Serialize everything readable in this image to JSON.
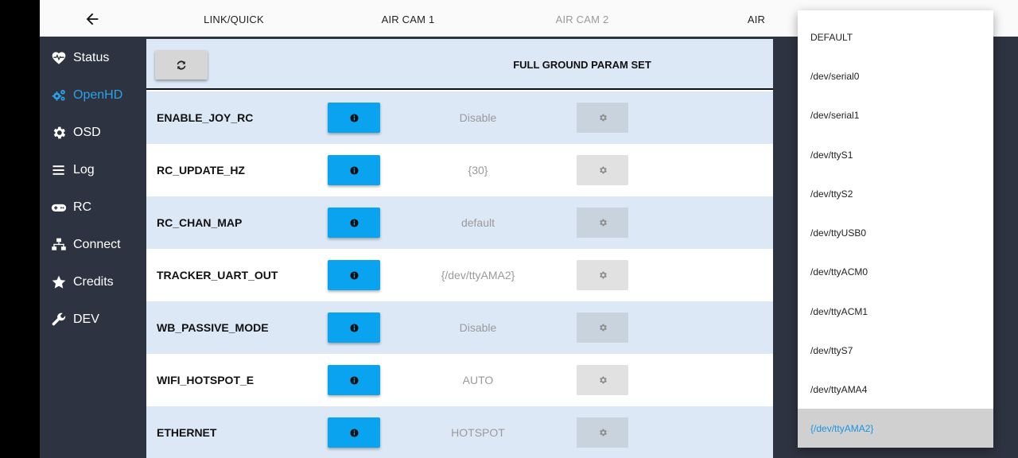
{
  "topbar": {
    "back_label": "back",
    "tabs": [
      {
        "label": "LINK/QUICK"
      },
      {
        "label": "AIR CAM 1"
      },
      {
        "label": "AIR CAM 2"
      },
      {
        "label": "AIR"
      }
    ]
  },
  "sidebar": {
    "items": [
      {
        "label": "Status",
        "icon": "heartbeat-icon"
      },
      {
        "label": "OpenHD",
        "icon": "cogs-icon",
        "active": true
      },
      {
        "label": "OSD",
        "icon": "gear-icon"
      },
      {
        "label": "Log",
        "icon": "menu-lines-icon"
      },
      {
        "label": "RC",
        "icon": "gamepad-icon"
      },
      {
        "label": "Connect",
        "icon": "network-icon"
      },
      {
        "label": "Credits",
        "icon": "star-icon"
      },
      {
        "label": "DEV",
        "icon": "wrench-icon"
      }
    ]
  },
  "main": {
    "title": "FULL GROUND PARAM SET",
    "params": [
      {
        "name": "ENABLE_JOY_RC",
        "value": "Disable"
      },
      {
        "name": "RC_UPDATE_HZ",
        "value": "{30}"
      },
      {
        "name": "RC_CHAN_MAP",
        "value": "default"
      },
      {
        "name": "TRACKER_UART_OUT",
        "value": "{/dev/ttyAMA2}"
      },
      {
        "name": "WB_PASSIVE_MODE",
        "value": "Disable"
      },
      {
        "name": "WIFI_HOTSPOT_E",
        "value": "AUTO"
      },
      {
        "name": "ETHERNET",
        "value": "HOTSPOT"
      }
    ]
  },
  "dropdown": {
    "options": [
      "DEFAULT",
      "/dev/serial0",
      "/dev/serial1",
      "/dev/ttyS1",
      "/dev/ttyS2",
      "/dev/ttyUSB0",
      "/dev/ttyACM0",
      "/dev/ttyACM1",
      "/dev/ttyS7",
      "/dev/ttyAMA4",
      "{/dev/ttyAMA2}"
    ],
    "selected": "{/dev/ttyAMA2}"
  },
  "colors": {
    "accent": "#2aa3e6",
    "info_button": "#0aa3ef",
    "sidebar_bg": "#2d3340",
    "row_alt": "#dce8f6"
  }
}
